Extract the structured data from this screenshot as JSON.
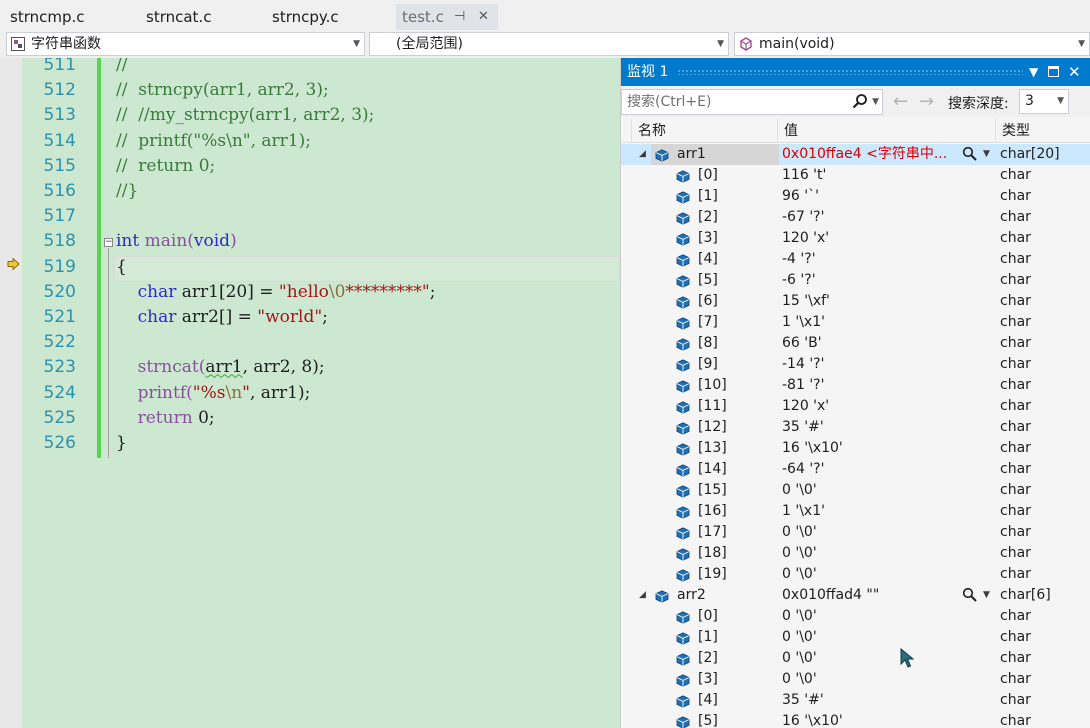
{
  "tabs": [
    {
      "label": "strncmp.c"
    },
    {
      "label": "strncat.c"
    },
    {
      "label": "strncpy.c"
    },
    {
      "label": "test.c",
      "pin": "⊣",
      "close": "✕"
    }
  ],
  "navbar": {
    "scope_combo": "字符串函数",
    "global_combo": "(全局范围)",
    "function_combo": "main(void)"
  },
  "editor": {
    "lines": [
      {
        "n": "511",
        "segments": [
          {
            "t": "//",
            "c": "cm"
          }
        ]
      },
      {
        "n": "512",
        "segments": [
          {
            "t": "//  strncpy(arr1, arr2, 3);",
            "c": "cm"
          }
        ]
      },
      {
        "n": "513",
        "segments": [
          {
            "t": "//  //my_strncpy(arr1, arr2, 3);",
            "c": "cm"
          }
        ]
      },
      {
        "n": "514",
        "segments": [
          {
            "t": "//  printf(\"%s\\n\", arr1);",
            "c": "cm"
          }
        ]
      },
      {
        "n": "515",
        "segments": [
          {
            "t": "//  return 0;",
            "c": "cm"
          }
        ]
      },
      {
        "n": "516",
        "segments": [
          {
            "t": "//}",
            "c": "cm"
          }
        ]
      },
      {
        "n": "517",
        "segments": []
      },
      {
        "n": "518",
        "segments": [
          {
            "t": "int",
            "c": "kw"
          },
          {
            "t": " main(",
            "c": "fn-purple"
          },
          {
            "t": "void",
            "c": "kw"
          },
          {
            "t": ")",
            "c": "fn-purple"
          }
        ]
      },
      {
        "n": "519",
        "segments": [
          {
            "t": "{",
            "c": "ident"
          }
        ]
      },
      {
        "n": "520",
        "segments": [
          {
            "t": "    char",
            "c": "kw"
          },
          {
            "t": " arr1[20] = ",
            "c": "ident"
          },
          {
            "t": "\"hello",
            "c": "str"
          },
          {
            "t": "\\0",
            "c": "esc"
          },
          {
            "t": "*********\"",
            "c": "str"
          },
          {
            "t": ";",
            "c": "ident"
          }
        ]
      },
      {
        "n": "521",
        "segments": [
          {
            "t": "    char",
            "c": "kw"
          },
          {
            "t": " arr2[] = ",
            "c": "ident"
          },
          {
            "t": "\"world\"",
            "c": "str"
          },
          {
            "t": ";",
            "c": "ident"
          }
        ]
      },
      {
        "n": "522",
        "segments": []
      },
      {
        "n": "523",
        "segments": [
          {
            "t": "    strncat(",
            "c": "fn-purple"
          },
          {
            "t": "arr1",
            "c": "squiggle"
          },
          {
            "t": ", arr2, 8);",
            "c": "ident"
          }
        ]
      },
      {
        "n": "524",
        "segments": [
          {
            "t": "    printf(",
            "c": "fn-purple"
          },
          {
            "t": "\"%s",
            "c": "str"
          },
          {
            "t": "\\n",
            "c": "esc"
          },
          {
            "t": "\"",
            "c": "str"
          },
          {
            "t": ", arr1);",
            "c": "ident"
          }
        ]
      },
      {
        "n": "525",
        "segments": [
          {
            "t": "    return",
            "c": "fn-purple"
          },
          {
            "t": " 0;",
            "c": "ident"
          }
        ]
      },
      {
        "n": "526",
        "segments": [
          {
            "t": "}",
            "c": "ident"
          }
        ]
      }
    ]
  },
  "watch": {
    "title": "监视 1",
    "search_placeholder": "搜索(Ctrl+E)",
    "search_depth_label": "搜索深度:",
    "search_depth_value": "3",
    "columns": {
      "name": "名称",
      "value": "值",
      "type": "类型"
    },
    "rows": [
      {
        "level": 0,
        "name": "arr1",
        "value": "0x010ffae4  <字符串中...",
        "type": "char[20]",
        "expanded": true,
        "selected": true,
        "red": true,
        "viz": true
      },
      {
        "level": 1,
        "name": "[0]",
        "value": "116 't'",
        "type": "char"
      },
      {
        "level": 1,
        "name": "[1]",
        "value": "96 '`'",
        "type": "char"
      },
      {
        "level": 1,
        "name": "[2]",
        "value": "-67 '?'",
        "type": "char"
      },
      {
        "level": 1,
        "name": "[3]",
        "value": "120 'x'",
        "type": "char"
      },
      {
        "level": 1,
        "name": "[4]",
        "value": "-4 '?'",
        "type": "char"
      },
      {
        "level": 1,
        "name": "[5]",
        "value": "-6 '?'",
        "type": "char"
      },
      {
        "level": 1,
        "name": "[6]",
        "value": "15 '\\xf'",
        "type": "char"
      },
      {
        "level": 1,
        "name": "[7]",
        "value": "1 '\\x1'",
        "type": "char"
      },
      {
        "level": 1,
        "name": "[8]",
        "value": "66 'B'",
        "type": "char"
      },
      {
        "level": 1,
        "name": "[9]",
        "value": "-14 '?'",
        "type": "char"
      },
      {
        "level": 1,
        "name": "[10]",
        "value": "-81 '?'",
        "type": "char"
      },
      {
        "level": 1,
        "name": "[11]",
        "value": "120 'x'",
        "type": "char"
      },
      {
        "level": 1,
        "name": "[12]",
        "value": "35 '#'",
        "type": "char"
      },
      {
        "level": 1,
        "name": "[13]",
        "value": "16 '\\x10'",
        "type": "char"
      },
      {
        "level": 1,
        "name": "[14]",
        "value": "-64 '?'",
        "type": "char"
      },
      {
        "level": 1,
        "name": "[15]",
        "value": "0 '\\0'",
        "type": "char"
      },
      {
        "level": 1,
        "name": "[16]",
        "value": "1 '\\x1'",
        "type": "char"
      },
      {
        "level": 1,
        "name": "[17]",
        "value": "0 '\\0'",
        "type": "char"
      },
      {
        "level": 1,
        "name": "[18]",
        "value": "0 '\\0'",
        "type": "char"
      },
      {
        "level": 1,
        "name": "[19]",
        "value": "0 '\\0'",
        "type": "char"
      },
      {
        "level": 0,
        "name": "arr2",
        "value": "0x010ffad4 \"\"",
        "type": "char[6]",
        "expanded": true,
        "viz": true
      },
      {
        "level": 1,
        "name": "[0]",
        "value": "0 '\\0'",
        "type": "char"
      },
      {
        "level": 1,
        "name": "[1]",
        "value": "0 '\\0'",
        "type": "char"
      },
      {
        "level": 1,
        "name": "[2]",
        "value": "0 '\\0'",
        "type": "char"
      },
      {
        "level": 1,
        "name": "[3]",
        "value": "0 '\\0'",
        "type": "char"
      },
      {
        "level": 1,
        "name": "[4]",
        "value": "35 '#'",
        "type": "char"
      },
      {
        "level": 1,
        "name": "[5]",
        "value": "16 '\\x10'",
        "type": "char"
      }
    ]
  },
  "colors": {
    "editor_bg": "#cde8d0",
    "accent": "#007acc",
    "changed_bar": "#56d64c",
    "error_red": "#d90000"
  },
  "icons": {
    "exec_pointer": "execution-arrow-icon",
    "variable": "cube-icon",
    "search": "magnifier-icon"
  }
}
